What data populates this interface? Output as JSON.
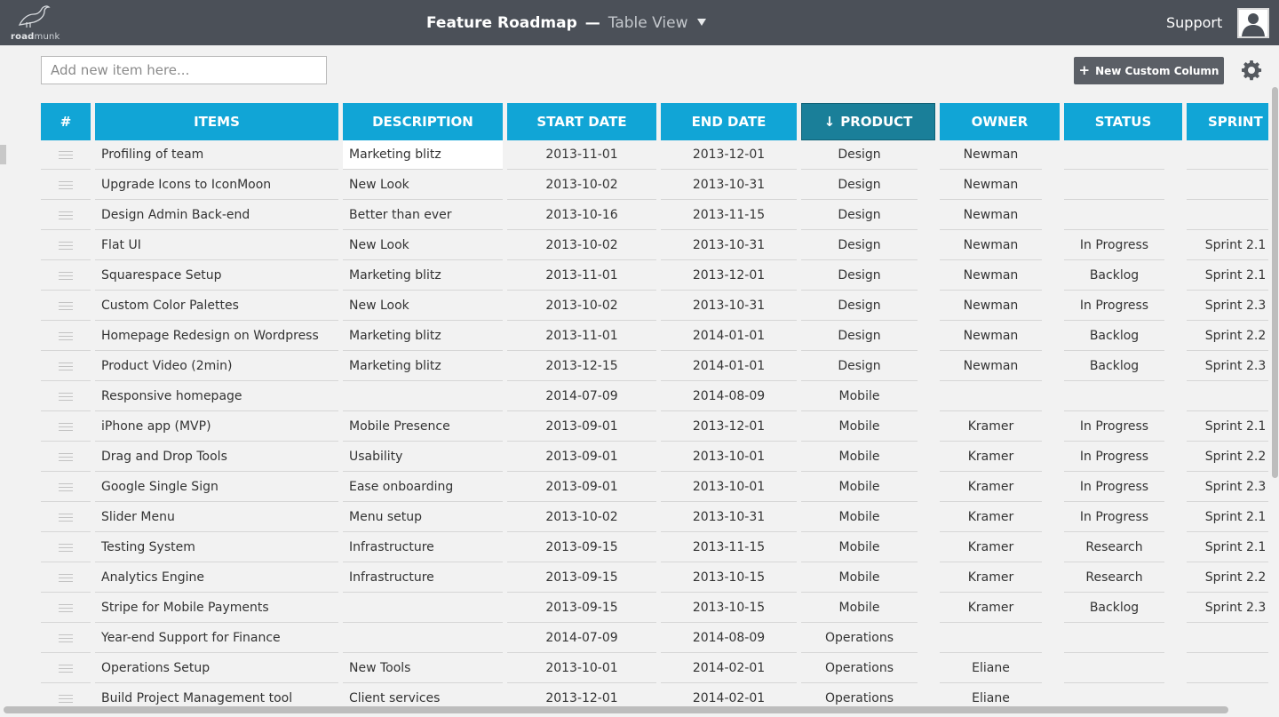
{
  "app": {
    "logo_prefix": "road",
    "logo_suffix": "munk",
    "title": "Feature Roadmap",
    "title_separator": "—",
    "view": "Table View",
    "support_label": "Support"
  },
  "toolbar": {
    "add_placeholder": "Add new item here...",
    "new_column_plus": "+",
    "new_column_label": "New Custom Column"
  },
  "table": {
    "headers": {
      "num": "#",
      "items": "ITEMS",
      "description": "DESCRIPTION",
      "start": "START DATE",
      "end": "END DATE",
      "product_arrow": "↓",
      "product": "PRODUCT",
      "owner": "OWNER",
      "status": "STATUS",
      "sprint": "SPRINT"
    },
    "sorted_column": "product",
    "rows": [
      {
        "item": "Profiling of team",
        "description": "Marketing blitz",
        "start": "2013-11-01",
        "end": "2013-12-01",
        "product": "Design",
        "owner": "Newman",
        "status": "",
        "sprint": ""
      },
      {
        "item": "Upgrade Icons to IconMoon",
        "description": "New Look",
        "start": "2013-10-02",
        "end": "2013-10-31",
        "product": "Design",
        "owner": "Newman",
        "status": "",
        "sprint": ""
      },
      {
        "item": "Design Admin Back-end",
        "description": "Better than ever",
        "start": "2013-10-16",
        "end": "2013-11-15",
        "product": "Design",
        "owner": "Newman",
        "status": "",
        "sprint": ""
      },
      {
        "item": "Flat UI",
        "description": "New Look",
        "start": "2013-10-02",
        "end": "2013-10-31",
        "product": "Design",
        "owner": "Newman",
        "status": "In Progress",
        "sprint": "Sprint 2.1"
      },
      {
        "item": "Squarespace Setup",
        "description": "Marketing blitz",
        "start": "2013-11-01",
        "end": "2013-12-01",
        "product": "Design",
        "owner": "Newman",
        "status": "Backlog",
        "sprint": "Sprint 2.1"
      },
      {
        "item": "Custom Color Palettes",
        "description": "New Look",
        "start": "2013-10-02",
        "end": "2013-10-31",
        "product": "Design",
        "owner": "Newman",
        "status": "In Progress",
        "sprint": "Sprint 2.3"
      },
      {
        "item": "Homepage Redesign on Wordpress",
        "description": "Marketing blitz",
        "start": "2013-11-01",
        "end": "2014-01-01",
        "product": "Design",
        "owner": "Newman",
        "status": "Backlog",
        "sprint": "Sprint 2.2"
      },
      {
        "item": "Product Video (2min)",
        "description": "Marketing blitz",
        "start": "2013-12-15",
        "end": "2014-01-01",
        "product": "Design",
        "owner": "Newman",
        "status": "Backlog",
        "sprint": "Sprint 2.3"
      },
      {
        "item": "Responsive homepage",
        "description": "",
        "start": "2014-07-09",
        "end": "2014-08-09",
        "product": "Mobile",
        "owner": "",
        "status": "",
        "sprint": ""
      },
      {
        "item": "iPhone app (MVP)",
        "description": "Mobile Presence",
        "start": "2013-09-01",
        "end": "2013-12-01",
        "product": "Mobile",
        "owner": "Kramer",
        "status": "In Progress",
        "sprint": "Sprint 2.1"
      },
      {
        "item": "Drag and Drop Tools",
        "description": "Usability",
        "start": "2013-09-01",
        "end": "2013-10-01",
        "product": "Mobile",
        "owner": "Kramer",
        "status": "In Progress",
        "sprint": "Sprint 2.2"
      },
      {
        "item": "Google Single Sign",
        "description": "Ease onboarding",
        "start": "2013-09-01",
        "end": "2013-10-01",
        "product": "Mobile",
        "owner": "Kramer",
        "status": "In Progress",
        "sprint": "Sprint 2.3"
      },
      {
        "item": "Slider Menu",
        "description": "Menu setup",
        "start": "2013-10-02",
        "end": "2013-10-31",
        "product": "Mobile",
        "owner": "Kramer",
        "status": "In Progress",
        "sprint": "Sprint 2.1"
      },
      {
        "item": "Testing System",
        "description": "Infrastructure",
        "start": "2013-09-15",
        "end": "2013-11-15",
        "product": "Mobile",
        "owner": "Kramer",
        "status": "Research",
        "sprint": "Sprint 2.1"
      },
      {
        "item": "Analytics Engine",
        "description": "Infrastructure",
        "start": "2013-09-15",
        "end": "2013-10-15",
        "product": "Mobile",
        "owner": "Kramer",
        "status": "Research",
        "sprint": "Sprint 2.2"
      },
      {
        "item": "Stripe for Mobile Payments",
        "description": "",
        "start": "2013-09-15",
        "end": "2013-10-15",
        "product": "Mobile",
        "owner": "Kramer",
        "status": "Backlog",
        "sprint": "Sprint 2.3"
      },
      {
        "item": "Year-end Support for Finance",
        "description": "",
        "start": "2014-07-09",
        "end": "2014-08-09",
        "product": "Operations",
        "owner": "",
        "status": "",
        "sprint": ""
      },
      {
        "item": "Operations Setup",
        "description": "New Tools",
        "start": "2013-10-01",
        "end": "2014-02-01",
        "product": "Operations",
        "owner": "Eliane",
        "status": "",
        "sprint": ""
      },
      {
        "item": "Build Project Management tool",
        "description": "Client services",
        "start": "2013-12-01",
        "end": "2014-02-01",
        "product": "Operations",
        "owner": "Eliane",
        "status": "",
        "sprint": ""
      }
    ]
  },
  "colors": {
    "topbar": "#4b5058",
    "header_blue": "#11a5d6",
    "header_sorted": "#1a7f99",
    "button_dark": "#5b5f66"
  },
  "icons": {
    "logo": "roadmunk-bird-logo",
    "caret": "caret-down-icon",
    "avatar": "user-avatar-icon",
    "gear": "gear-icon",
    "drag": "drag-handle-icon",
    "sort": "sort-down-arrow-icon"
  }
}
